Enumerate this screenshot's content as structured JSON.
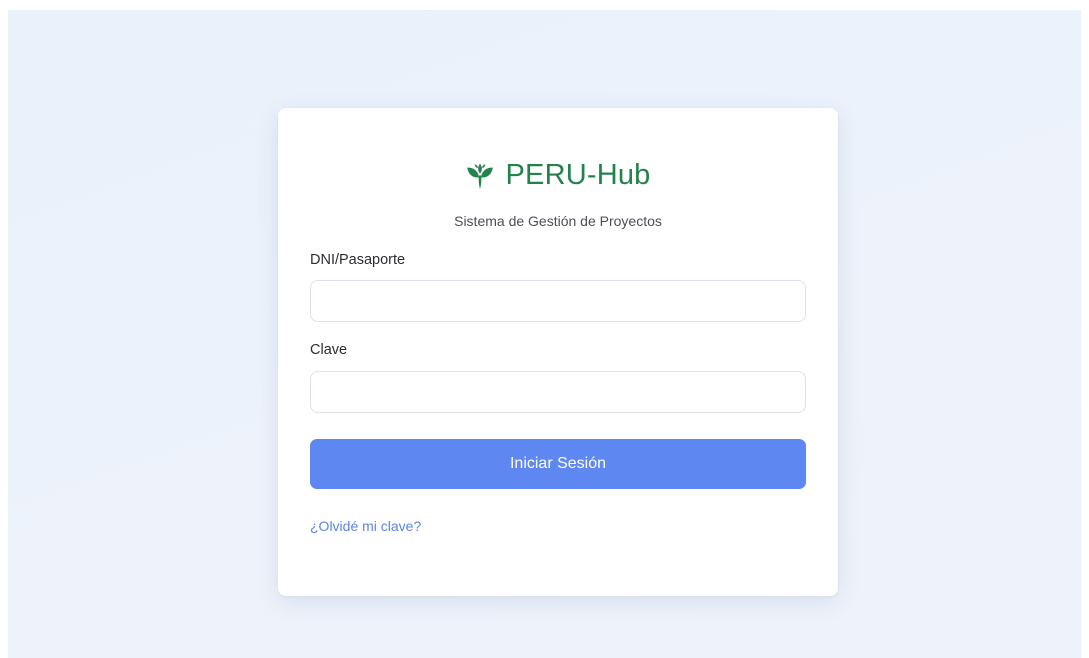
{
  "brand": {
    "name": "PERU-Hub",
    "icon": "sprout-icon",
    "color": "#24834a"
  },
  "subtitle": "Sistema de Gestión de Proyectos",
  "form": {
    "dni_label": "DNI/Pasaporte",
    "dni_value": "",
    "dni_placeholder": "",
    "password_label": "Clave",
    "password_value": "",
    "password_placeholder": "",
    "submit_label": "Iniciar Sesión",
    "submit_color": "#5f87f2",
    "forgot_label": "¿Olvidé mi clave?",
    "forgot_color": "#5b84e8"
  }
}
